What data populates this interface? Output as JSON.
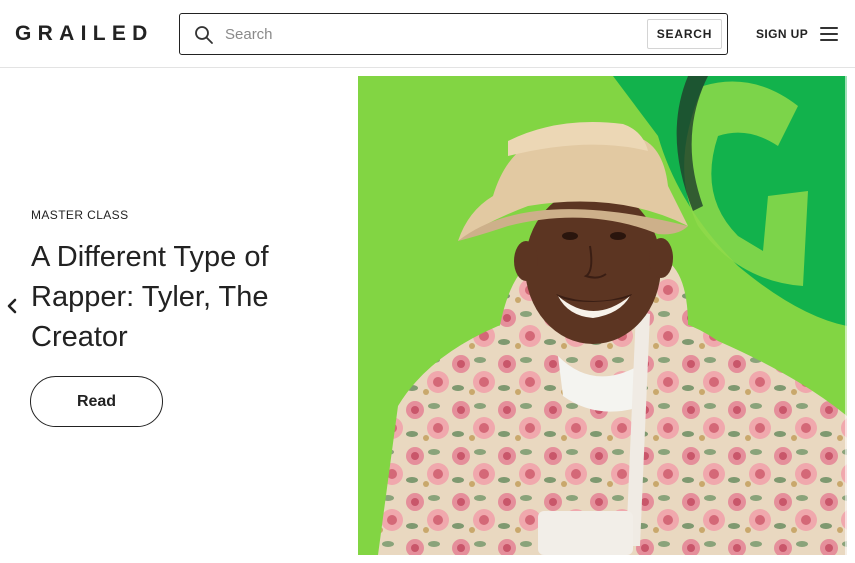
{
  "header": {
    "logo": "GRAILED",
    "search": {
      "placeholder": "Search",
      "button_label": "SEARCH"
    },
    "signup_label": "SIGN UP"
  },
  "feature": {
    "category": "MASTER CLASS",
    "headline": "A Different Type of Rapper: Tyler, The Creator",
    "read_label": "Read"
  },
  "icons": {
    "search": "search-icon",
    "menu": "hamburger-menu-icon",
    "prev": "chevron-left-icon"
  },
  "colors": {
    "background": "#ffffff",
    "text": "#222222",
    "hero_green": "#7ed23f",
    "hero_sign_green": "#12b24c"
  }
}
